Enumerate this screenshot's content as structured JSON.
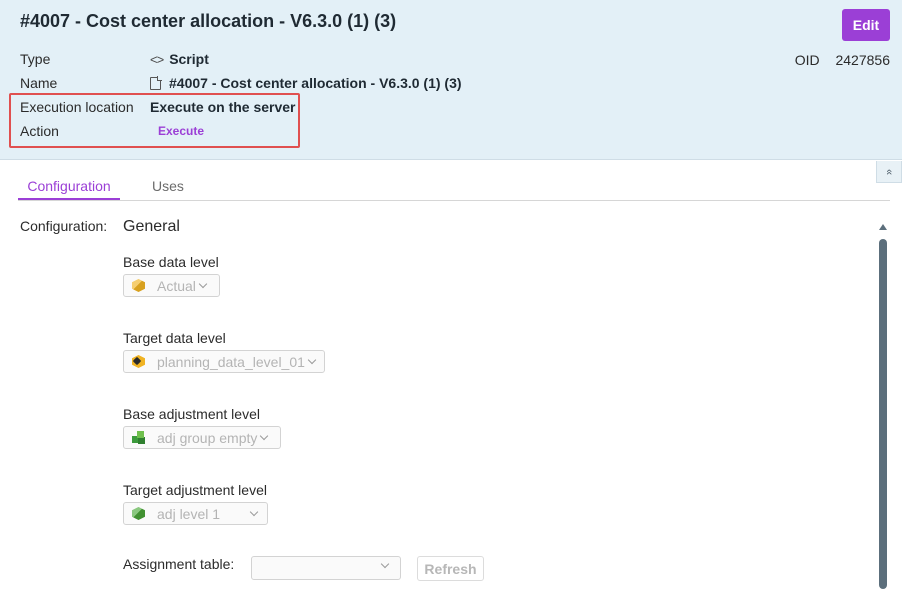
{
  "header": {
    "title": "#4007 - Cost center allocation - V6.3.0 (1) (3)",
    "edit_label": "Edit",
    "oid_label": "OID",
    "oid_value": "2427856",
    "properties": {
      "type_label": "Type",
      "type_value": "Script",
      "type_icon": "<>",
      "name_label": "Name",
      "name_value": "#4007 - Cost center allocation - V6.3.0 (1) (3)",
      "exec_location_label": "Execution location",
      "exec_location_value": "Execute on the server",
      "action_label": "Action",
      "action_value": "Execute"
    },
    "collapse_icon": "«"
  },
  "tabs": [
    {
      "label": "Configuration",
      "active": true
    },
    {
      "label": "Uses",
      "active": false
    }
  ],
  "config": {
    "label": "Configuration:",
    "section_title": "General",
    "fields": [
      {
        "label": "Base data level",
        "value": "Actual",
        "icon": "cube-gold-icon"
      },
      {
        "label": "Target data level",
        "value": "planning_data_level_01",
        "icon": "cube-target-icon"
      },
      {
        "label": "Base adjustment level",
        "value": "adj group empty",
        "icon": "cube-group-icon"
      },
      {
        "label": "Target adjustment level",
        "value": "adj level 1",
        "icon": "cube-green-icon"
      }
    ],
    "assignment_label": "Assignment table:",
    "assignment_value": "",
    "refresh_label": "Refresh"
  },
  "colors": {
    "accent": "#9b3fd6",
    "header_bg": "#e3f0f7",
    "highlight": "#e05050",
    "scrollbar": "#5c6f7c"
  }
}
